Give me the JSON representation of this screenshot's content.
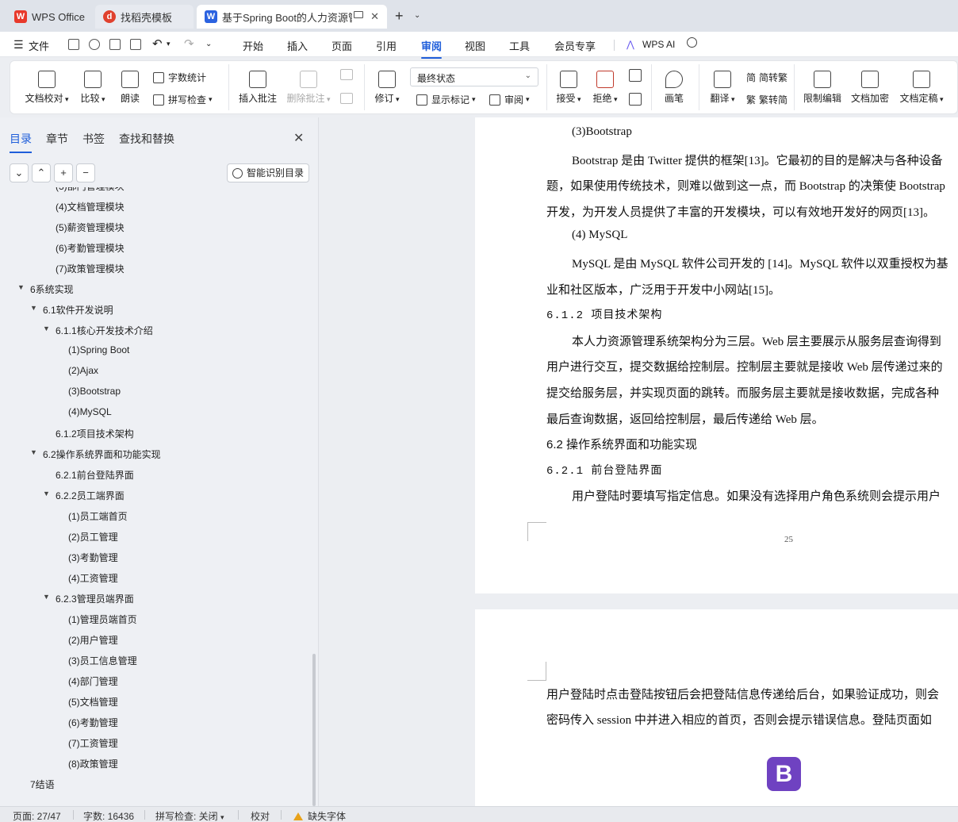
{
  "tabs": [
    {
      "label": "WPS Office",
      "icon": "wps-logo-icon"
    },
    {
      "label": "找稻壳模板",
      "icon": "docer-icon"
    },
    {
      "label": "基于Spring Boot的人力资源管",
      "icon": "wps-writer-icon"
    }
  ],
  "menu": {
    "file": "文件",
    "items": [
      "开始",
      "插入",
      "页面",
      "引用",
      "审阅",
      "视图",
      "工具",
      "会员专享"
    ],
    "active": "审阅",
    "ai": "WPS AI"
  },
  "ribbon": {
    "doc_check": "文档校对",
    "compare": "比较",
    "read": "朗读",
    "word_count": "字数统计",
    "spell_check": "拼写检查",
    "insert_comment": "插入批注",
    "delete_comment": "删除批注",
    "revise": "修订",
    "final_state": "最终状态",
    "show_marks": "显示标记",
    "review": "审阅",
    "accept": "接受",
    "reject": "拒绝",
    "pen": "画笔",
    "translate": "翻译",
    "to_traditional": "简转繁",
    "to_simplified": "繁转简",
    "restrict_edit": "限制编辑",
    "encrypt": "文档加密",
    "finalize": "文档定稿"
  },
  "nav": {
    "tabs": [
      "目录",
      "章节",
      "书签",
      "查找和替换"
    ],
    "active_tab": "目录",
    "smart_toc": "智能识别目录",
    "toc": [
      {
        "text": "(3)部门管理模块",
        "level": 2
      },
      {
        "text": "(4)文档管理模块",
        "level": 2
      },
      {
        "text": "(5)薪资管理模块",
        "level": 2
      },
      {
        "text": "(6)考勤管理模块",
        "level": 2
      },
      {
        "text": "(7)政策管理模块",
        "level": 2
      },
      {
        "text": "6系统实现",
        "level": 0,
        "expanded": true
      },
      {
        "text": "6.1软件开发说明",
        "level": 1,
        "expanded": true
      },
      {
        "text": "6.1.1核心开发技术介绍",
        "level": 2,
        "expanded": true
      },
      {
        "text": "(1)Spring Boot",
        "level": 3
      },
      {
        "text": "(2)Ajax",
        "level": 3
      },
      {
        "text": "(3)Bootstrap",
        "level": 3
      },
      {
        "text": "(4)MySQL",
        "level": 3
      },
      {
        "text": "6.1.2项目技术架构",
        "level": 2
      },
      {
        "text": "6.2操作系统界面和功能实现",
        "level": 1,
        "expanded": true
      },
      {
        "text": "6.2.1前台登陆界面",
        "level": 2
      },
      {
        "text": "6.2.2员工端界面",
        "level": 2,
        "expanded": true
      },
      {
        "text": "(1)员工端首页",
        "level": 3
      },
      {
        "text": "(2)员工管理",
        "level": 3
      },
      {
        "text": "(3)考勤管理",
        "level": 3
      },
      {
        "text": "(4)工资管理",
        "level": 3
      },
      {
        "text": "6.2.3管理员端界面",
        "level": 2,
        "expanded": true
      },
      {
        "text": "(1)管理员端首页",
        "level": 3
      },
      {
        "text": "(2)用户管理",
        "level": 3
      },
      {
        "text": "(3)员工信息管理",
        "level": 3
      },
      {
        "text": "(4)部门管理",
        "level": 3
      },
      {
        "text": "(5)文档管理",
        "level": 3
      },
      {
        "text": "(6)考勤管理",
        "level": 3
      },
      {
        "text": "(7)工资管理",
        "level": 3
      },
      {
        "text": "(8)政策管理",
        "level": 3
      },
      {
        "text": "7结语",
        "level": 0
      }
    ]
  },
  "document": {
    "page1_lines": [
      {
        "text": "(3)Bootstrap",
        "style": "body",
        "indent": true
      },
      {
        "text": "Bootstrap 是由 Twitter 提供的框架[13]。它最初的目的是解决与各种设备",
        "style": "body",
        "indent": true
      },
      {
        "text": "题，如果使用传统技术，则难以做到这一点，而 Bootstrap 的决策使 Bootstrap",
        "style": "body",
        "indent": false
      },
      {
        "text": "开发，为开发人员提供了丰富的开发模块，可以有效地开发好的网页[13]。",
        "style": "body",
        "indent": false
      },
      {
        "text": "(4)  MySQL",
        "style": "body",
        "indent": true
      },
      {
        "text": "MySQL 是由 MySQL 软件公司开发的 [14]。MySQL 软件以双重授权为基",
        "style": "body",
        "indent": true
      },
      {
        "text": "业和社区版本，广泛用于开发中小网站[15]。",
        "style": "body",
        "indent": false
      },
      {
        "text": "6.1.2  项目技术架构",
        "style": "h3",
        "indent": false
      },
      {
        "text": "本人力资源管理系统架构分为三层。Web 层主要展示从服务层查询得到",
        "style": "body",
        "indent": true
      },
      {
        "text": "用户进行交互，提交数据给控制层。控制层主要就是接收 Web 层传递过来的",
        "style": "body",
        "indent": false
      },
      {
        "text": "提交给服务层，并实现页面的跳转。而服务层主要就是接收数据，完成各种",
        "style": "body",
        "indent": false
      },
      {
        "text": "最后查询数据，返回给控制层，最后传递给 Web 层。",
        "style": "body",
        "indent": false
      },
      {
        "text": "6.2  操作系统界面和功能实现",
        "style": "h2",
        "indent": false
      },
      {
        "text": "6.2.1  前台登陆界面",
        "style": "h3",
        "indent": false
      },
      {
        "text": "用户登陆时要填写指定信息。如果没有选择用户角色系统则会提示用户",
        "style": "body",
        "indent": true
      }
    ],
    "page_number": "25",
    "page2_lines": [
      "用户登陆时点击登陆按钮后会把登陆信息传递给后台，如果验证成功，则会",
      "密码传入 session 中并进入相应的首页，否则会提示错误信息。登陆页面如"
    ],
    "logo_letter": "B"
  },
  "status": {
    "page": "页面: 27/47",
    "words": "字数: 16436",
    "spell": "拼写检查: 关闭",
    "proof": "校对",
    "missing_font": "缺失字体"
  }
}
